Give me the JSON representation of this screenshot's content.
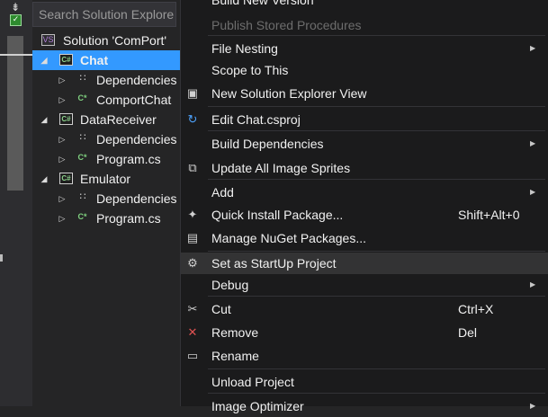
{
  "explorer": {
    "search_placeholder": "Search Solution Explore",
    "solution": "Solution 'ComPort'",
    "projects": [
      {
        "name": "Chat",
        "selected": true,
        "children": [
          "Dependencies",
          "ComportChat"
        ]
      },
      {
        "name": "DataReceiver",
        "selected": false,
        "children": [
          "Dependencies",
          "Program.cs"
        ]
      },
      {
        "name": "Emulator",
        "selected": false,
        "children": [
          "Dependencies",
          "Program.cs"
        ]
      }
    ],
    "icons": {
      "solution": "VS",
      "project": "C#",
      "dependencies": "∷",
      "csfile": "C*"
    }
  },
  "menu": {
    "items": [
      {
        "label": "Build New Version",
        "icon": "",
        "shortcut": "",
        "submenu": false,
        "disabled": false
      },
      {
        "label": "Publish Stored Procedures",
        "icon": "",
        "shortcut": "",
        "submenu": false,
        "disabled": true
      },
      {
        "label": "File Nesting",
        "icon": "",
        "shortcut": "",
        "submenu": true,
        "disabled": false
      },
      {
        "label": "Scope to This",
        "icon": "",
        "shortcut": "",
        "submenu": false,
        "disabled": false
      },
      {
        "label": "New Solution Explorer View",
        "icon": "▣",
        "shortcut": "",
        "submenu": false,
        "disabled": false
      },
      {
        "label": "Edit Chat.csproj",
        "icon": "↻",
        "shortcut": "",
        "submenu": false,
        "disabled": false
      },
      {
        "label": "Build Dependencies",
        "icon": "",
        "shortcut": "",
        "submenu": true,
        "disabled": false
      },
      {
        "label": "Update All Image Sprites",
        "icon": "⧉",
        "shortcut": "",
        "submenu": false,
        "disabled": false
      },
      {
        "label": "Add",
        "icon": "",
        "shortcut": "",
        "submenu": true,
        "disabled": false
      },
      {
        "label": "Quick Install Package...",
        "icon": "✦",
        "shortcut": "Shift+Alt+0",
        "submenu": false,
        "disabled": false
      },
      {
        "label": "Manage NuGet Packages...",
        "icon": "▤",
        "shortcut": "",
        "submenu": false,
        "disabled": false
      },
      {
        "label": "Set as StartUp Project",
        "icon": "⚙",
        "shortcut": "",
        "submenu": false,
        "disabled": false,
        "hover": true
      },
      {
        "label": "Debug",
        "icon": "",
        "shortcut": "",
        "submenu": true,
        "disabled": false
      },
      {
        "label": "Cut",
        "icon": "✂",
        "shortcut": "Ctrl+X",
        "submenu": false,
        "disabled": false
      },
      {
        "label": "Remove",
        "icon": "✕",
        "shortcut": "Del",
        "submenu": false,
        "disabled": false
      },
      {
        "label": "Rename",
        "icon": "▭",
        "shortcut": "",
        "submenu": false,
        "disabled": false
      },
      {
        "label": "Unload Project",
        "icon": "",
        "shortcut": "",
        "submenu": false,
        "disabled": false
      },
      {
        "label": "Image Optimizer",
        "icon": "",
        "shortcut": "",
        "submenu": true,
        "disabled": false
      }
    ],
    "submenu_arrow": "▶"
  },
  "colors": {
    "selection": "#3399ff",
    "remove_icon": "#e05252",
    "edit_icon": "#4ea4ff"
  }
}
